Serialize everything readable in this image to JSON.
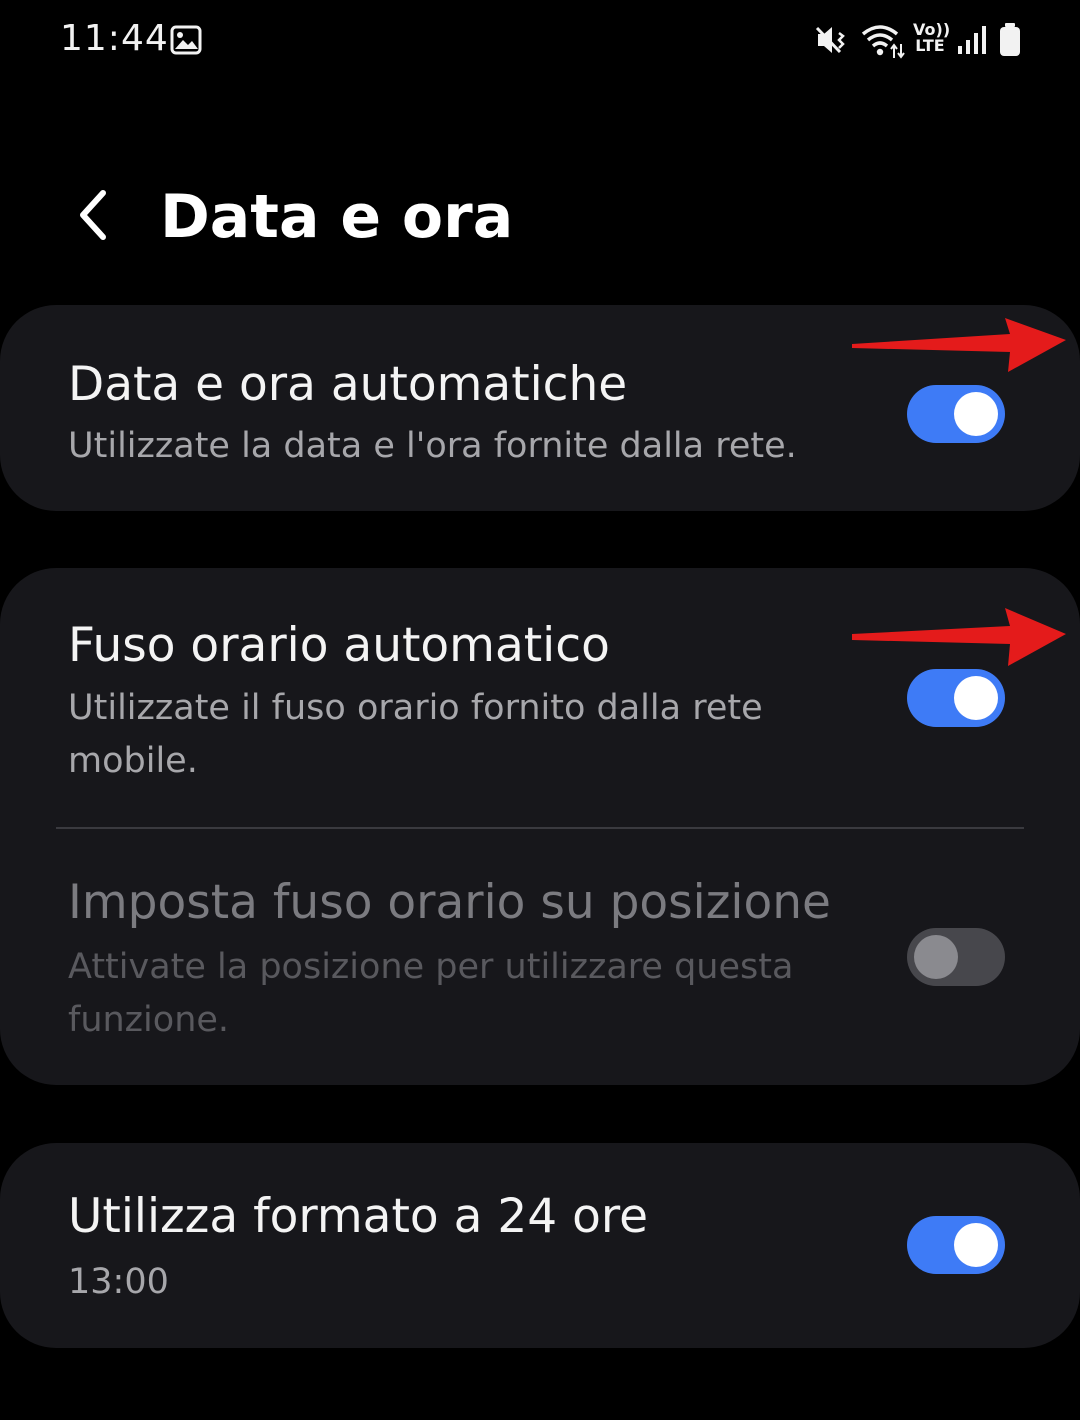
{
  "status_bar": {
    "time": "11:44",
    "icons": [
      "gallery-notification-icon",
      "mute-vibrate-icon",
      "wifi-icon",
      "volte-icon",
      "signal-icon",
      "battery-icon"
    ],
    "volte_label_top": "Vo))",
    "volte_label_bottom": "LTE"
  },
  "header": {
    "title": "Data e ora",
    "back_icon": "chevron-left-icon"
  },
  "settings": {
    "auto_datetime": {
      "title": "Data e ora automatiche",
      "subtitle": "Utilizzate la data e l'ora fornite dalla rete.",
      "enabled": true
    },
    "auto_timezone": {
      "title": "Fuso orario automatico",
      "subtitle": "Utilizzate il fuso orario fornito dalla rete mobile.",
      "enabled": true
    },
    "location_timezone": {
      "title": "Imposta fuso orario su posizione",
      "subtitle": "Attivate la posizione per utilizzare questa funzione.",
      "enabled": false,
      "disabled": true
    },
    "format_24h": {
      "title": "Utilizza formato a 24 ore",
      "subtitle": "13:00",
      "enabled": true
    }
  },
  "colors": {
    "background": "#000000",
    "card": "#17171b",
    "toggle_on": "#3e7bf6",
    "toggle_off": "#47474c",
    "annotation_arrow": "#e41b1b"
  }
}
